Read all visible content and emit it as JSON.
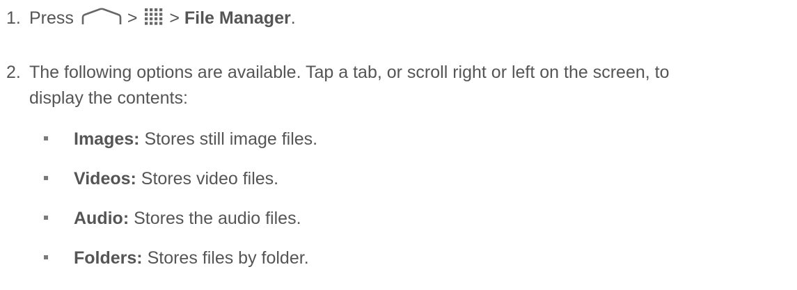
{
  "step1": {
    "number": "1.",
    "press_text": "Press",
    "separator1": ">",
    "separator2": ">",
    "destination": "File Manager",
    "end_punct": ".",
    "icons": [
      "home-icon",
      "apps-grid-icon"
    ]
  },
  "step2": {
    "number": "2.",
    "text_line1": "The following options are available. Tap a tab, or scroll right or left on the screen, to",
    "text_line2": "display the contents:"
  },
  "options": [
    {
      "label": "Images:",
      "description": "Stores still image files."
    },
    {
      "label": "Videos:",
      "description": "Stores video files."
    },
    {
      "label": "Audio:",
      "description": "Stores the audio files."
    },
    {
      "label": "Folders:",
      "description": "Stores files by folder."
    }
  ],
  "colors": {
    "text": "#555555",
    "bullet": "#7a7a7a",
    "icon_stroke": "#666666"
  }
}
